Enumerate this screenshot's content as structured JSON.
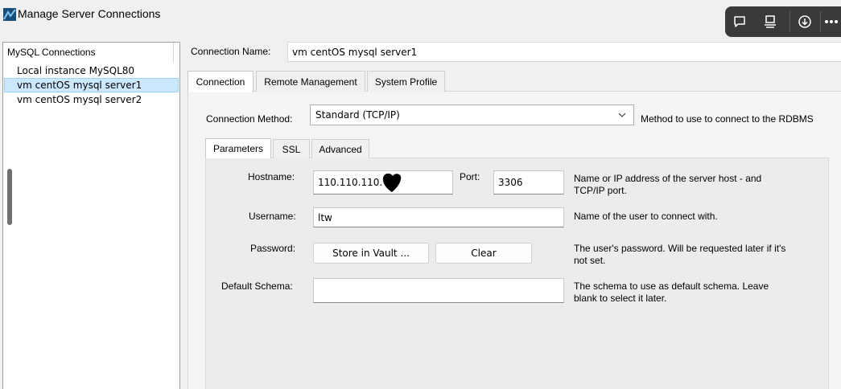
{
  "window": {
    "title": "Manage Server Connections"
  },
  "toolbar": {
    "icons": [
      "comment-icon",
      "screen-share-icon",
      "download-icon",
      "more-icon"
    ]
  },
  "connections": {
    "header": "MySQL Connections",
    "items": [
      {
        "label": "Local instance MySQL80",
        "selected": false
      },
      {
        "label": "vm centOS mysql server1",
        "selected": true
      },
      {
        "label": "vm centOS mysql server2",
        "selected": false
      }
    ]
  },
  "form": {
    "connection_name_label": "Connection Name:",
    "connection_name_value": "vm centOS mysql server1",
    "tabs": [
      {
        "label": "Connection",
        "active": true
      },
      {
        "label": "Remote Management",
        "active": false
      },
      {
        "label": "System Profile",
        "active": false
      }
    ],
    "method_label": "Connection Method:",
    "method_value": "Standard (TCP/IP)",
    "method_desc": "Method to use to connect to the RDBMS",
    "subtabs": [
      {
        "label": "Parameters",
        "active": true
      },
      {
        "label": "SSL",
        "active": false
      },
      {
        "label": "Advanced",
        "active": false
      }
    ],
    "hostname_label": "Hostname:",
    "hostname_value": "110.110.110.",
    "port_label": "Port:",
    "port_value": "3306",
    "hostname_desc_1": "Name or IP address of the server host - and",
    "hostname_desc_2": "TCP/IP port.",
    "username_label": "Username:",
    "username_value": "ltw",
    "username_desc": "Name of the user to connect with.",
    "password_label": "Password:",
    "store_vault_label": "Store in Vault ...",
    "clear_label": "Clear",
    "password_desc_1": "The user's password. Will be requested later if it's",
    "password_desc_2": "not set.",
    "schema_label": "Default Schema:",
    "schema_value": "",
    "schema_desc_1": "The schema to use as default schema. Leave",
    "schema_desc_2": "blank to select it later."
  }
}
